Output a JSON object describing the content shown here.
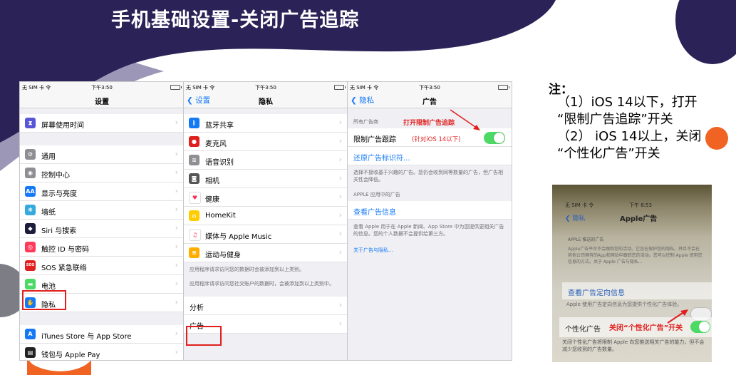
{
  "title": "手机基础设置-关闭广告追踪",
  "phone1": {
    "status": {
      "carrier": "无 SIM 卡 令",
      "time": "下午3:50"
    },
    "nav_title": "设置",
    "groups": [
      [
        {
          "label": "屏幕使用时间",
          "icon": "hourglass-icon",
          "icon_glyph": "⧗",
          "color": "#5856d6"
        }
      ],
      [
        {
          "label": "通用",
          "icon": "gear-icon",
          "icon_glyph": "⚙",
          "color": "#8e8e93"
        },
        {
          "label": "控制中心",
          "icon": "toggles-icon",
          "icon_glyph": "◉",
          "color": "#8e8e93"
        },
        {
          "label": "显示与亮度",
          "icon": "display-icon",
          "icon_glyph": "AA",
          "color": "#1479f6"
        },
        {
          "label": "墙纸",
          "icon": "wallpaper-icon",
          "icon_glyph": "❋",
          "color": "#35aadc"
        },
        {
          "label": "Siri 与搜索",
          "icon": "siri-icon",
          "icon_glyph": "◆",
          "color": "#1c1c3c"
        },
        {
          "label": "触控 ID 与密码",
          "icon": "fingerprint-icon",
          "icon_glyph": "◎",
          "color": "#ff3b5c"
        },
        {
          "label": "SOS 紧急联络",
          "icon": "sos-icon",
          "icon_glyph": "SOS",
          "color": "#e0201e"
        },
        {
          "label": "电池",
          "icon": "battery-icon",
          "icon_glyph": "▬",
          "color": "#4cd964"
        },
        {
          "label": "隐私",
          "icon": "hand-icon",
          "icon_glyph": "✋",
          "color": "#1479f6"
        }
      ],
      [
        {
          "label": "iTunes Store 与 App Store",
          "icon": "appstore-icon",
          "icon_glyph": "A",
          "color": "#1479f6"
        },
        {
          "label": "钱包与 Apple Pay",
          "icon": "wallet-icon",
          "icon_glyph": "▤",
          "color": "#222222"
        }
      ]
    ]
  },
  "phone2": {
    "status": {
      "carrier": "无 SIM 卡 令",
      "time": "下午3:50"
    },
    "back": "设置",
    "nav_title": "隐私",
    "items": [
      {
        "label": "蓝牙共享",
        "icon": "bluetooth-icon",
        "icon_glyph": "ᛒ",
        "color": "#1479f6"
      },
      {
        "label": "麦克风",
        "icon": "microphone-icon",
        "icon_glyph": "●",
        "color": "#e0201e"
      },
      {
        "label": "语音识别",
        "icon": "waveform-icon",
        "icon_glyph": "≋",
        "color": "#8e8e93"
      },
      {
        "label": "相机",
        "icon": "camera-icon",
        "icon_glyph": "◙",
        "color": "#555555"
      },
      {
        "label": "健康",
        "icon": "heart-icon",
        "icon_glyph": "♥",
        "color": "#ffffff",
        "glyph_color": "#ff2d55"
      },
      {
        "label": "HomeKit",
        "icon": "home-icon",
        "icon_glyph": "⌂",
        "color": "#ffcc00"
      },
      {
        "label": "媒体与 Apple Music",
        "icon": "music-icon",
        "icon_glyph": "♫",
        "color": "#ffffff",
        "glyph_color": "#ff2d55"
      },
      {
        "label": "运动与健身",
        "icon": "fitness-icon",
        "icon_glyph": "≡",
        "color": "#ffae00"
      }
    ],
    "note1": "应用程序请求访问您的数据时会被添加到以上类别。",
    "note2": "应用程序请求访问您社交账户的数据时，会被添加到以上类别中。",
    "items2": [
      {
        "label": "分析"
      },
      {
        "label": "广告"
      }
    ]
  },
  "phone3": {
    "status": {
      "carrier": "无 SIM 卡 令",
      "time": "下午3:50"
    },
    "back": "隐私",
    "nav_title": "广告",
    "sec1": "所有广告商",
    "annot1": "打开限制广告追踪",
    "limit_label": "限制广告跟踪",
    "annot2": "(针对iOS 14以下)",
    "reset_link": "还原广告标识符...",
    "note1": "选择不接收基于兴趣的广告。您仍会收到同等数量的广告，但广告相关性会降低。",
    "sec2": "APPLE 应用中的广告",
    "view_link": "查看广告信息",
    "note2": "查看 Apple 用于在 Apple 新闻、App Store 中为您提供更相关广告的信息。您的个人数据不会提供给第三方。",
    "about_link": "关于广告与隐私..."
  },
  "note": {
    "head": "注：",
    "lines": [
      "（1）iOS 14以下，打开",
      "“限制广告追踪”开关",
      "（2） iOS 14以上，关闭",
      "“个性化广告”开关"
    ]
  },
  "photo": {
    "status": "无 SIM 卡 令",
    "time": "下午 8:53",
    "back": "隐私",
    "title": "Apple广告",
    "sec": "APPLE 推送的广告",
    "desc": "Apple广告平台不会跟踪您的活动。它旨在保护您的隐私。并且不会在其他公司拥有的App和网站中跟踪您的活动。您可以控制 Apple 使用您信息的方式。关于 Apple 广告与隐私...",
    "row1": "查看广告定向信息",
    "mid": "Apple 使用广告定向信息为您提供个性化广告体验。",
    "row2_label": "个性化广告",
    "row2_annot": "关闭“个性化广告”开关",
    "foot": "关闭个性化广告将限制 Apple 向您推送相关广告的能力，但不会减少您收到的广告数量。"
  }
}
